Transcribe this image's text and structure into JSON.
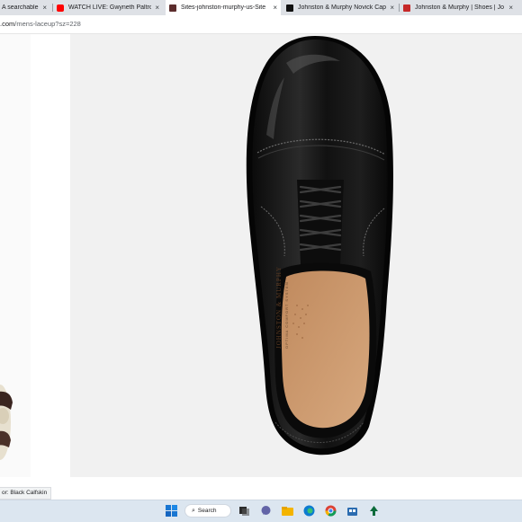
{
  "browser": {
    "tabs": [
      {
        "title": "A searchable",
        "close": "×",
        "favicon_color": "#5f6368"
      },
      {
        "title": "WATCH LIVE: Gwyneth Paltrow S",
        "close": "×",
        "favicon_color": "#ff0000"
      },
      {
        "title": "Sites-johnston-murphy-us-Site",
        "close": "×",
        "favicon_color": "#5c2d2d",
        "active": true
      },
      {
        "title": "Johnston & Murphy Novick Cap",
        "close": "×",
        "favicon_color": "#111111"
      },
      {
        "title": "Johnston & Murphy | Shoes | Jo",
        "close": "×",
        "favicon_color": "#c62828"
      }
    ],
    "url_host": ".com",
    "url_path": "/mens-laceup?sz=228"
  },
  "product": {
    "image_alt": "Men's black calfskin cap-toe oxford",
    "insole_brand": "JOHNSTON & MURPHY",
    "insole_subtext": "OPTIMA COMFORT SYSTEM",
    "color_label": "or: Black Calfskin"
  },
  "taskbar": {
    "search_label": "Search",
    "apps": [
      "windows-start",
      "search",
      "task-view",
      "chat",
      "file-explorer",
      "edge",
      "chrome",
      "store",
      "news"
    ]
  },
  "colors": {
    "tab_strip": "#dee1e6",
    "hero_bg": "#f1f1f1",
    "shoe_leather": "#111111",
    "lining": "#c9956b",
    "taskbar": "#dce6f0"
  }
}
